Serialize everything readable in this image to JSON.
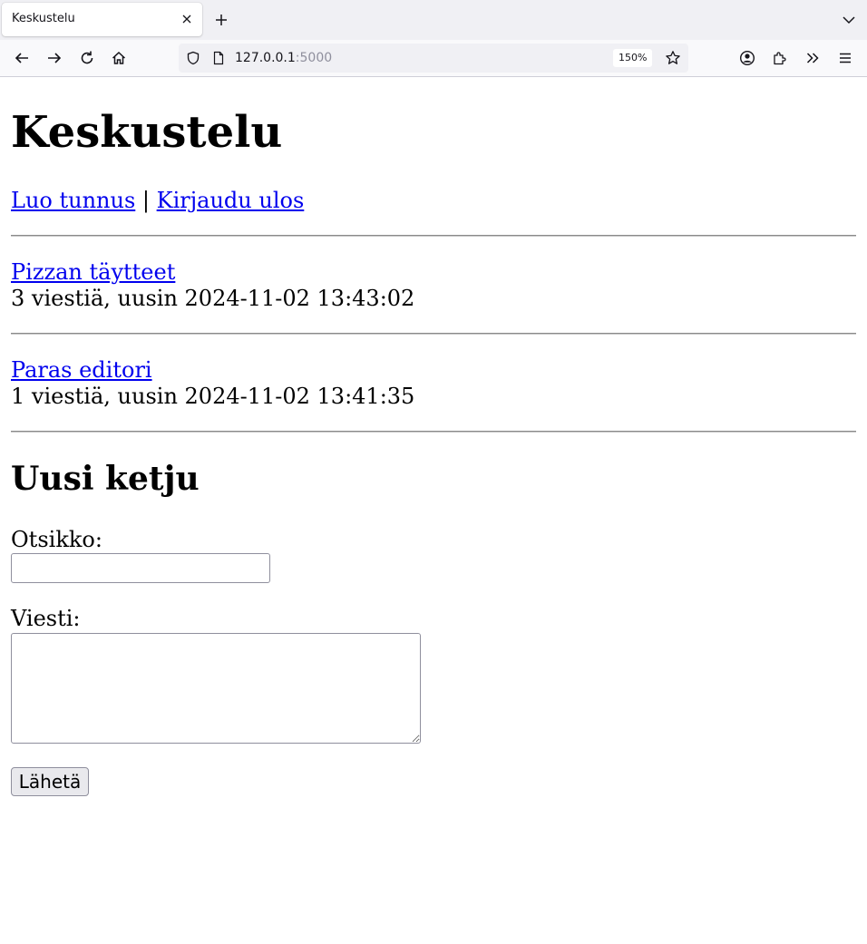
{
  "browser": {
    "tab_title": "Keskustelu",
    "url_host": "127.0.0.1",
    "url_port": ":5000",
    "zoom": "150%"
  },
  "page": {
    "title": "Keskustelu",
    "nav": {
      "register": "Luo tunnus",
      "separator": "|",
      "logout": "Kirjaudu ulos"
    },
    "threads": [
      {
        "title": "Pizzan täytteet",
        "meta": "3 viestiä, uusin 2024-11-02 13:43:02"
      },
      {
        "title": "Paras editori",
        "meta": "1 viestiä, uusin 2024-11-02 13:41:35"
      }
    ],
    "new_thread": {
      "heading": "Uusi ketju",
      "title_label": "Otsikko:",
      "title_value": "",
      "message_label": "Viesti:",
      "message_value": "",
      "submit_label": "Lähetä"
    }
  },
  "colors": {
    "link": "#0000ee",
    "tabbar": "#f0f0f4",
    "navbar": "#f9f9fb"
  }
}
